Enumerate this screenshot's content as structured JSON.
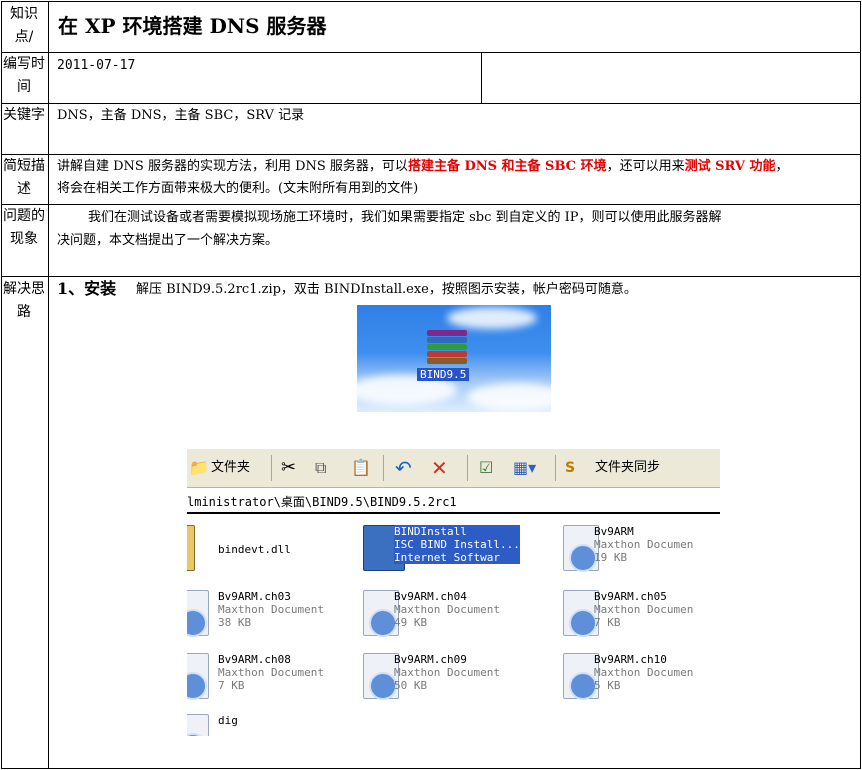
{
  "rows": {
    "topic": {
      "label": "知识点/",
      "title": "在 XP 环境搭建 DNS 服务器"
    },
    "date": {
      "label": "编写时间",
      "value": "2011-07-17"
    },
    "keywords": {
      "label": "关键字",
      "value": "DNS，主备 DNS，主备 SBC，SRV 记录"
    },
    "summary": {
      "label": "简短描述",
      "part1": "讲解自建 DNS 服务器的实现方法，利用 DNS 服务器，可以",
      "red1": "搭建主备 DNS 和主备 SBC 环境",
      "part2": "，还可以用来",
      "red2": "测试 SRV 功能",
      "part3": "，",
      "line2": "将会在相关工作方面带来极大的便利。(文末附所有用到的文件)"
    },
    "problem": {
      "label": "问题的现象",
      "line1": "我们在测试设备或者需要模拟现场施工环境时，我们如果需要指定 sbc 到自定义的 IP，则可以使用此服务器解",
      "line2": "决问题，本文档提出了一个解决方案。"
    },
    "solution": {
      "label": "解决思路",
      "heading": "1、安装",
      "text": "解压 BIND9.5.2rc1.zip，双击 BINDInstall.exe，按照图示安装，帐户密码可随意。"
    }
  },
  "desktop_icon": {
    "label": "BIND9.5",
    "icon": "winrar-archive-icon"
  },
  "explorer": {
    "toolbar": {
      "folders": "文件夹",
      "sync": "文件夹同步"
    },
    "address": "lministrator\\桌面\\BIND9.5\\BIND9.5.2rc1",
    "files": [
      {
        "name": "bindevt.dll",
        "line2": "",
        "line3": "",
        "icon": "dll-gear-icon"
      },
      {
        "name": "BINDInstall",
        "line2": "ISC BIND Install...",
        "line3": "Internet Softwar",
        "icon": "installer-computer-icon",
        "selected": true
      },
      {
        "name": "Bv9ARM",
        "line2": "Maxthon Documen",
        "line3": "19 KB",
        "icon": "maxthon-document-icon"
      },
      {
        "name": "Bv9ARM.ch03",
        "line2": "Maxthon Document",
        "line3": "38 KB",
        "icon": "maxthon-document-icon"
      },
      {
        "name": "Bv9ARM.ch04",
        "line2": "Maxthon Document",
        "line3": "49 KB",
        "icon": "maxthon-document-icon"
      },
      {
        "name": "Bv9ARM.ch05",
        "line2": "Maxthon Documen",
        "line3": "7 KB",
        "icon": "maxthon-document-icon"
      },
      {
        "name": "Bv9ARM.ch08",
        "line2": "Maxthon Document",
        "line3": "7 KB",
        "icon": "maxthon-document-icon"
      },
      {
        "name": "Bv9ARM.ch09",
        "line2": "Maxthon Document",
        "line3": "50 KB",
        "icon": "maxthon-document-icon"
      },
      {
        "name": "Bv9ARM.ch10",
        "line2": "Maxthon Documen",
        "line3": "5 KB",
        "icon": "maxthon-document-icon"
      },
      {
        "name": "dig",
        "line2": "",
        "line3": "",
        "icon": "maxthon-document-icon"
      }
    ]
  }
}
